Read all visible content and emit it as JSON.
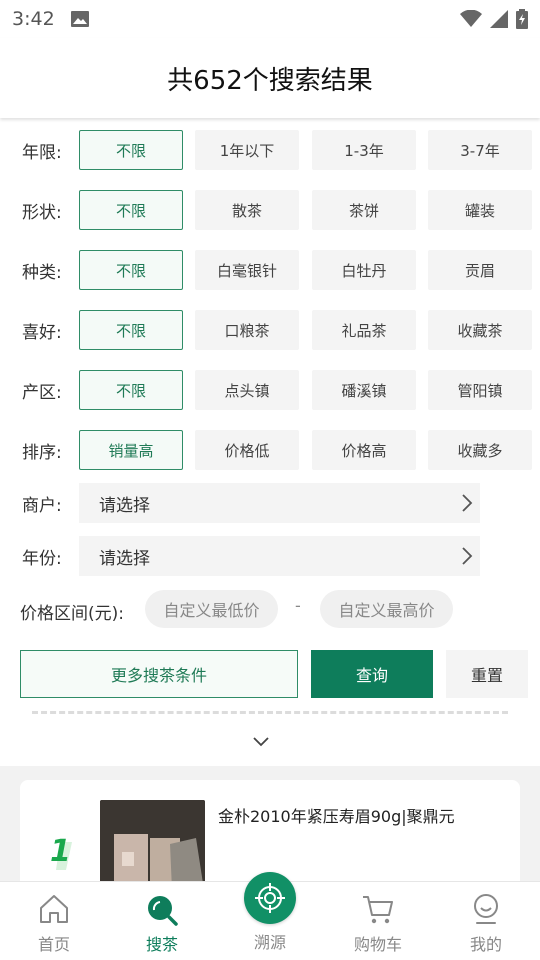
{
  "status_bar": {
    "time": "3:42"
  },
  "header": {
    "title": "共652个搜索结果"
  },
  "filters": [
    {
      "label": "年限:",
      "options": [
        "不限",
        "1年以下",
        "1-3年",
        "3-7年"
      ],
      "selected": 0
    },
    {
      "label": "形状:",
      "options": [
        "不限",
        "散茶",
        "茶饼",
        "罐装"
      ],
      "selected": 0
    },
    {
      "label": "种类:",
      "options": [
        "不限",
        "白毫银针",
        "白牡丹",
        "贡眉"
      ],
      "selected": 0
    },
    {
      "label": "喜好:",
      "options": [
        "不限",
        "口粮茶",
        "礼品茶",
        "收藏茶"
      ],
      "selected": 0
    },
    {
      "label": "产区:",
      "options": [
        "不限",
        "点头镇",
        "磻溪镇",
        "管阳镇"
      ],
      "selected": 0
    },
    {
      "label": "排序:",
      "options": [
        "销量高",
        "价格低",
        "价格高",
        "收藏多"
      ],
      "selected": 0
    }
  ],
  "merchant": {
    "label": "商户:",
    "value": "请选择"
  },
  "year": {
    "label": "年份:",
    "value": "请选择"
  },
  "price": {
    "label": "价格区间(元):",
    "min_placeholder": "自定义最低价",
    "dash": "-",
    "max_placeholder": "自定义最高价"
  },
  "actions": {
    "more": "更多搜茶条件",
    "query": "查询",
    "reset": "重置"
  },
  "results": [
    {
      "rank": "1",
      "title": "金朴2010年紧压寿眉90g|聚鼎元"
    }
  ],
  "colors": {
    "accent": "#0e7d5b",
    "accent_border": "#2f8c67"
  },
  "nav": [
    {
      "label": "首页",
      "icon": "home-icon",
      "active": false
    },
    {
      "label": "搜茶",
      "icon": "search-tea-icon",
      "active": true
    },
    {
      "label": "溯源",
      "icon": "trace-icon",
      "active": false
    },
    {
      "label": "购物车",
      "icon": "cart-icon",
      "active": false
    },
    {
      "label": "我的",
      "icon": "profile-icon",
      "active": false
    }
  ]
}
